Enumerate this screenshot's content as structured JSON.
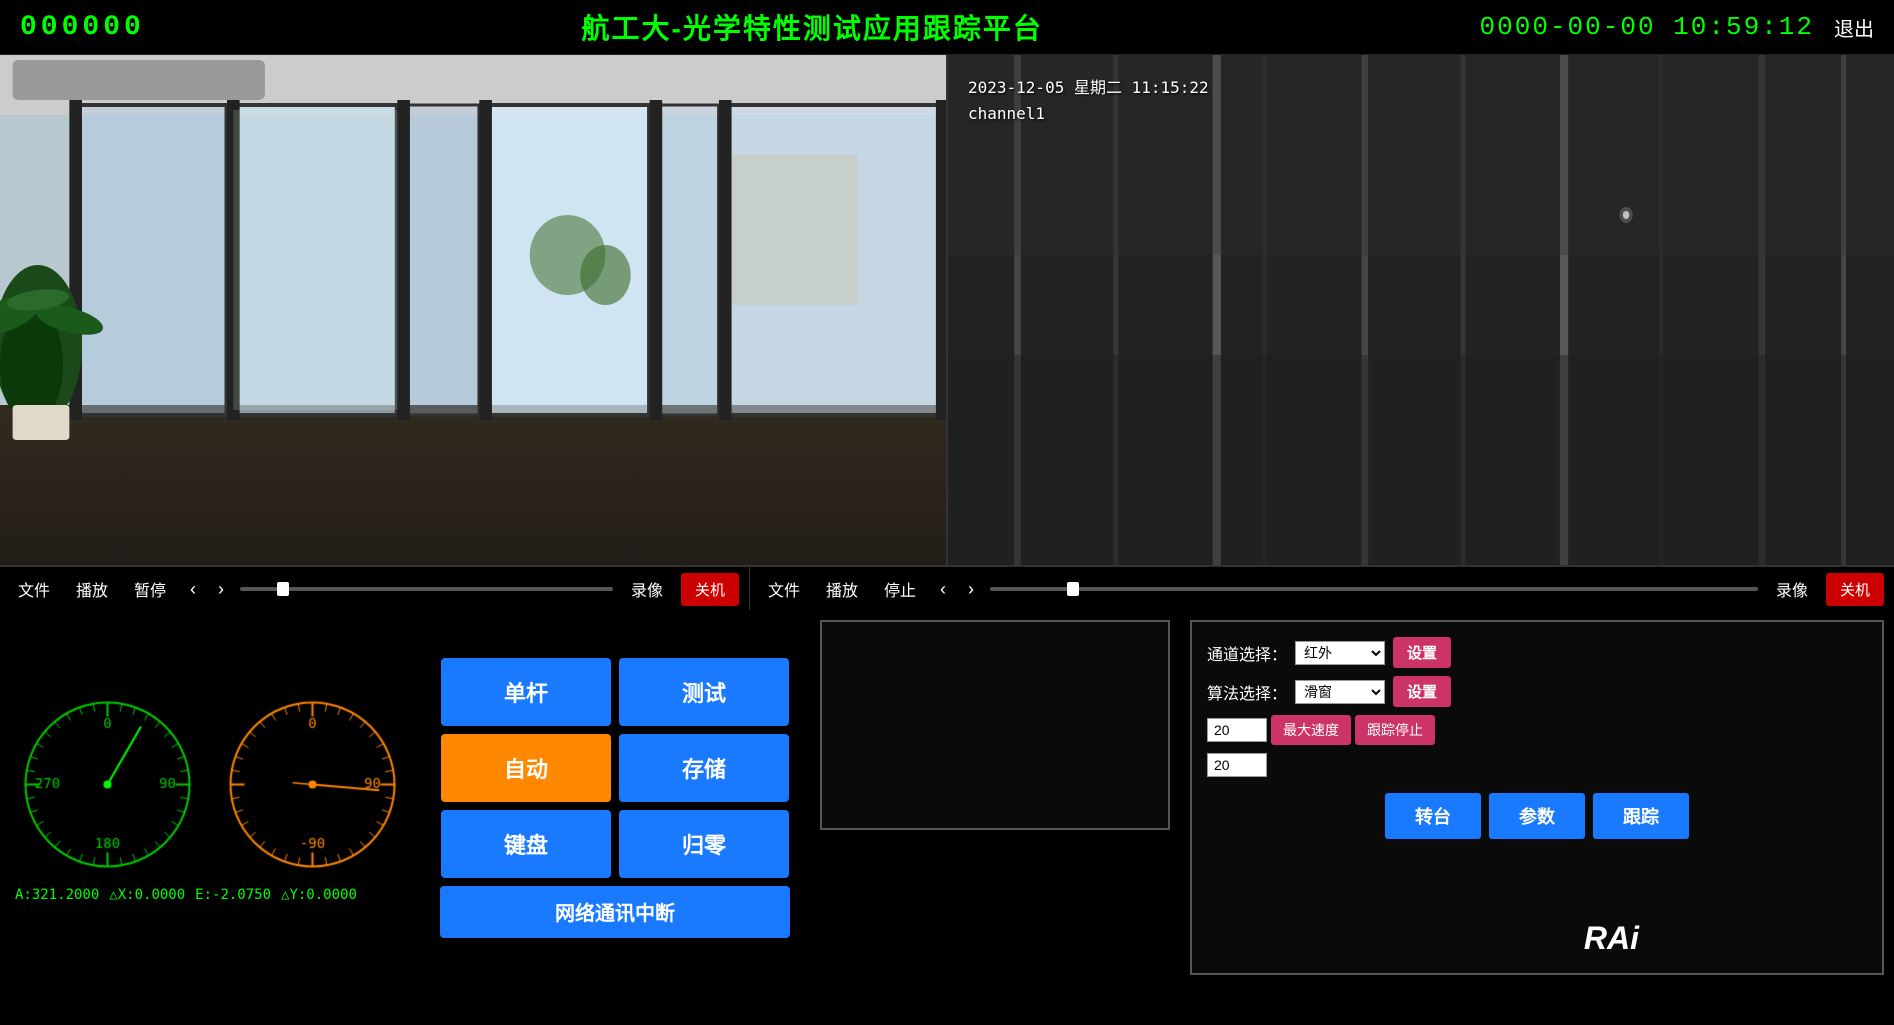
{
  "header": {
    "counter_left": "000000",
    "title": "航工大-光学特性测试应用跟踪平台",
    "datetime": "0000-00-00 10:59:12",
    "exit_label": "退出"
  },
  "video_left": {
    "controls": {
      "file": "文件",
      "play": "播放",
      "pause": "暂停",
      "record": "录像",
      "shutdown": "关机"
    }
  },
  "video_right": {
    "timestamp": "2023-12-05 星期二 11:15:22",
    "channel": "channel1",
    "controls": {
      "file": "文件",
      "play": "播放",
      "stop": "停止",
      "record": "录像",
      "shutdown": "关机"
    }
  },
  "center_controls": {
    "btn_single": "单杆",
    "btn_test": "测试",
    "btn_auto": "自动",
    "btn_save": "存储",
    "btn_keyboard": "键盘",
    "btn_reset": "归零",
    "btn_network": "网络通讯中断"
  },
  "tracking": {
    "channel_label": "通道选择：",
    "channel_value": "红外",
    "algorithm_label": "算法选择：",
    "algorithm_value": "滑窗",
    "input1_value": "20",
    "input2_value": "20",
    "set_label": "设置",
    "max_speed_label": "最大速度",
    "track_stop_label": "跟踪停止",
    "btn_turntable": "转台",
    "btn_params": "参数",
    "btn_track": "跟踪"
  },
  "status_bar": {
    "a_value": "A:321.2000",
    "dx_value": "△X:0.0000",
    "e_value": "E:-2.0750",
    "dy_value": "△Y:0.0000"
  },
  "rai": {
    "label": "RAi"
  },
  "gauges": {
    "green_needle_angle": -30,
    "orange_needle_angle": 5
  }
}
